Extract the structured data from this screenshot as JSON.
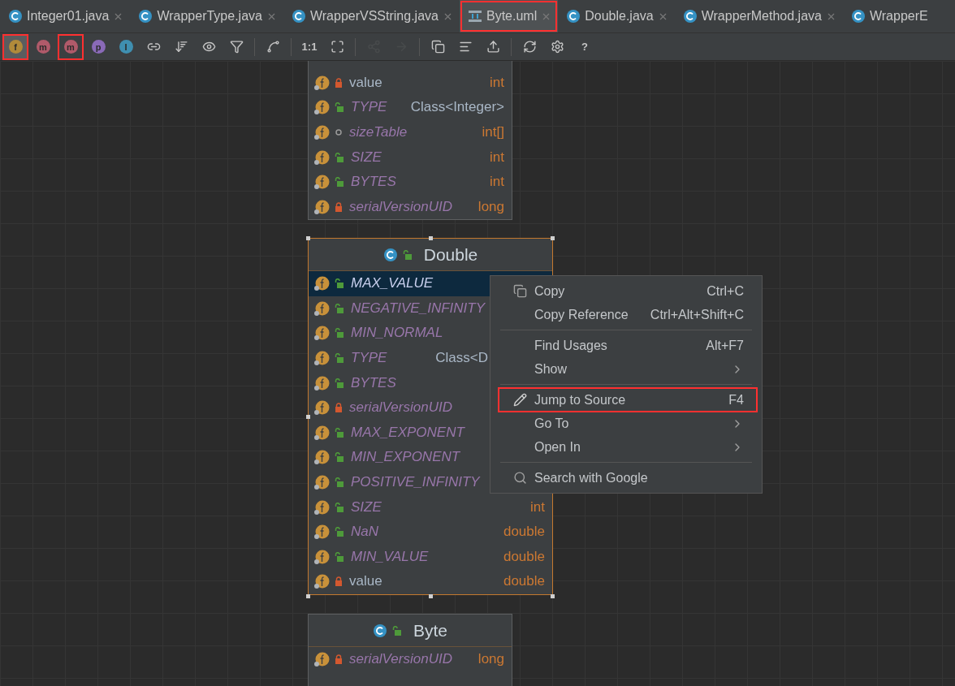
{
  "tabs": [
    {
      "label": "Integer01.java",
      "kind": "class",
      "selected": false,
      "highlighted": false
    },
    {
      "label": "WrapperType.java",
      "kind": "class",
      "selected": false,
      "highlighted": false
    },
    {
      "label": "WrapperVSString.java",
      "kind": "class",
      "selected": false,
      "highlighted": false
    },
    {
      "label": "Byte.uml",
      "kind": "uml",
      "selected": true,
      "highlighted": true
    },
    {
      "label": "Double.java",
      "kind": "class",
      "selected": false,
      "highlighted": false
    },
    {
      "label": "WrapperMethod.java",
      "kind": "class",
      "selected": false,
      "highlighted": false
    },
    {
      "label": "WrapperE",
      "kind": "class",
      "selected": false,
      "highlighted": false
    }
  ],
  "toolbar": [
    {
      "kind": "badge",
      "glyph": "f",
      "color": "#b08a3a",
      "pressed": true,
      "highlighted": true,
      "disabled": false
    },
    {
      "kind": "badge",
      "glyph": "m",
      "color": "#b05a6a",
      "pressed": false,
      "highlighted": false,
      "disabled": false
    },
    {
      "kind": "badge",
      "glyph": "m",
      "color": "#b05a6a",
      "pressed": false,
      "highlighted": true,
      "disabled": false
    },
    {
      "kind": "badge",
      "glyph": "p",
      "color": "#8a6ab8",
      "pressed": false,
      "highlighted": false,
      "disabled": false
    },
    {
      "kind": "badge",
      "glyph": "I",
      "color": "#3f8fb0",
      "pressed": false,
      "highlighted": false,
      "disabled": false
    },
    {
      "kind": "link",
      "pressed": false,
      "highlighted": false,
      "disabled": false
    },
    {
      "kind": "sort",
      "pressed": false,
      "highlighted": false,
      "disabled": false
    },
    {
      "kind": "eye",
      "pressed": false,
      "highlighted": false,
      "disabled": false
    },
    {
      "kind": "filter",
      "pressed": false,
      "highlighted": false,
      "disabled": false
    },
    {
      "kind": "sep"
    },
    {
      "kind": "route",
      "pressed": false,
      "highlighted": false,
      "disabled": false
    },
    {
      "kind": "sep"
    },
    {
      "kind": "text",
      "glyph": "1:1",
      "pressed": false,
      "highlighted": false,
      "disabled": false
    },
    {
      "kind": "fit",
      "pressed": false,
      "highlighted": false,
      "disabled": false
    },
    {
      "kind": "sep"
    },
    {
      "kind": "share",
      "pressed": false,
      "highlighted": false,
      "disabled": true
    },
    {
      "kind": "arrow",
      "pressed": false,
      "highlighted": false,
      "disabled": true
    },
    {
      "kind": "sep"
    },
    {
      "kind": "copy",
      "pressed": false,
      "highlighted": false,
      "disabled": false
    },
    {
      "kind": "layout",
      "pressed": false,
      "highlighted": false,
      "disabled": false
    },
    {
      "kind": "export",
      "pressed": false,
      "highlighted": false,
      "disabled": false
    },
    {
      "kind": "sep"
    },
    {
      "kind": "refresh",
      "pressed": false,
      "highlighted": false,
      "disabled": false
    },
    {
      "kind": "gear",
      "pressed": false,
      "highlighted": false,
      "disabled": false
    },
    {
      "kind": "text",
      "glyph": "?",
      "pressed": false,
      "highlighted": false,
      "disabled": false
    }
  ],
  "nodes": [
    {
      "fields": [
        {
          "kind": "private",
          "name": "value",
          "type": "int",
          "object_type": false,
          "static": false,
          "selected": false
        },
        {
          "kind": "public",
          "name": "TYPE",
          "type": "Class<Integer>",
          "object_type": true,
          "static": true,
          "selected": false
        },
        {
          "kind": "package",
          "name": "sizeTable",
          "type": "int[]",
          "object_type": false,
          "static": true,
          "selected": false
        },
        {
          "kind": "public",
          "name": "SIZE",
          "type": "int",
          "object_type": false,
          "static": true,
          "selected": false
        },
        {
          "kind": "public",
          "name": "BYTES",
          "type": "int",
          "object_type": false,
          "static": true,
          "selected": false
        },
        {
          "kind": "private",
          "name": "serialVersionUID",
          "type": "long",
          "object_type": false,
          "static": true,
          "selected": false
        }
      ],
      "selected": false
    },
    {
      "title": "Double",
      "selected": true,
      "fields": [
        {
          "kind": "public",
          "name": "MAX_VALUE",
          "static": true,
          "selected": true
        },
        {
          "kind": "public",
          "name": "NEGATIVE_INFINITY",
          "static": true,
          "selected": false
        },
        {
          "kind": "public",
          "name": "MIN_NORMAL",
          "static": true,
          "selected": false
        },
        {
          "kind": "public",
          "name": "TYPE",
          "type": "Class<D",
          "object_type": true,
          "static": true,
          "selected": false
        },
        {
          "kind": "public",
          "name": "BYTES",
          "static": true,
          "selected": false
        },
        {
          "kind": "private",
          "name": "serialVersionUID",
          "static": true,
          "selected": false
        },
        {
          "kind": "public",
          "name": "MAX_EXPONENT",
          "static": true,
          "selected": false
        },
        {
          "kind": "public",
          "name": "MIN_EXPONENT",
          "static": true,
          "selected": false
        },
        {
          "kind": "public",
          "name": "POSITIVE_INFINITY",
          "static": true,
          "selected": false
        },
        {
          "kind": "public",
          "name": "SIZE",
          "type": "int",
          "object_type": false,
          "static": true,
          "selected": false
        },
        {
          "kind": "public",
          "name": "NaN",
          "type": "double",
          "object_type": false,
          "static": true,
          "selected": false
        },
        {
          "kind": "public",
          "name": "MIN_VALUE",
          "type": "double",
          "object_type": false,
          "static": true,
          "selected": false
        },
        {
          "kind": "private",
          "name": "value",
          "type": "double",
          "object_type": false,
          "static": false,
          "selected": false
        }
      ]
    },
    {
      "title": "Byte",
      "selected": false,
      "fields": [
        {
          "kind": "private",
          "name": "serialVersionUID",
          "type": "long",
          "object_type": false,
          "static": true,
          "selected": false
        }
      ]
    }
  ],
  "context_menu": [
    {
      "kind": "copy",
      "label": "Copy",
      "shortcut": "Ctrl+C",
      "submenu": false,
      "highlighted": false
    },
    {
      "kind": "plain",
      "label": "Copy Reference",
      "shortcut": "Ctrl+Alt+Shift+C",
      "submenu": false,
      "highlighted": false
    },
    {
      "kind": "separator"
    },
    {
      "kind": "plain",
      "label": "Find Usages",
      "shortcut": "Alt+F7",
      "submenu": false,
      "highlighted": false
    },
    {
      "kind": "plain",
      "label": "Show",
      "submenu": true,
      "highlighted": false
    },
    {
      "kind": "separator"
    },
    {
      "kind": "edit",
      "label": "Jump to Source",
      "shortcut": "F4",
      "submenu": false,
      "highlighted": true
    },
    {
      "kind": "plain",
      "label": "Go To",
      "submenu": true,
      "highlighted": false
    },
    {
      "kind": "plain",
      "label": "Open In",
      "submenu": true,
      "highlighted": false
    },
    {
      "kind": "separator"
    },
    {
      "kind": "search",
      "label": "Search with Google",
      "submenu": false,
      "highlighted": false
    }
  ]
}
